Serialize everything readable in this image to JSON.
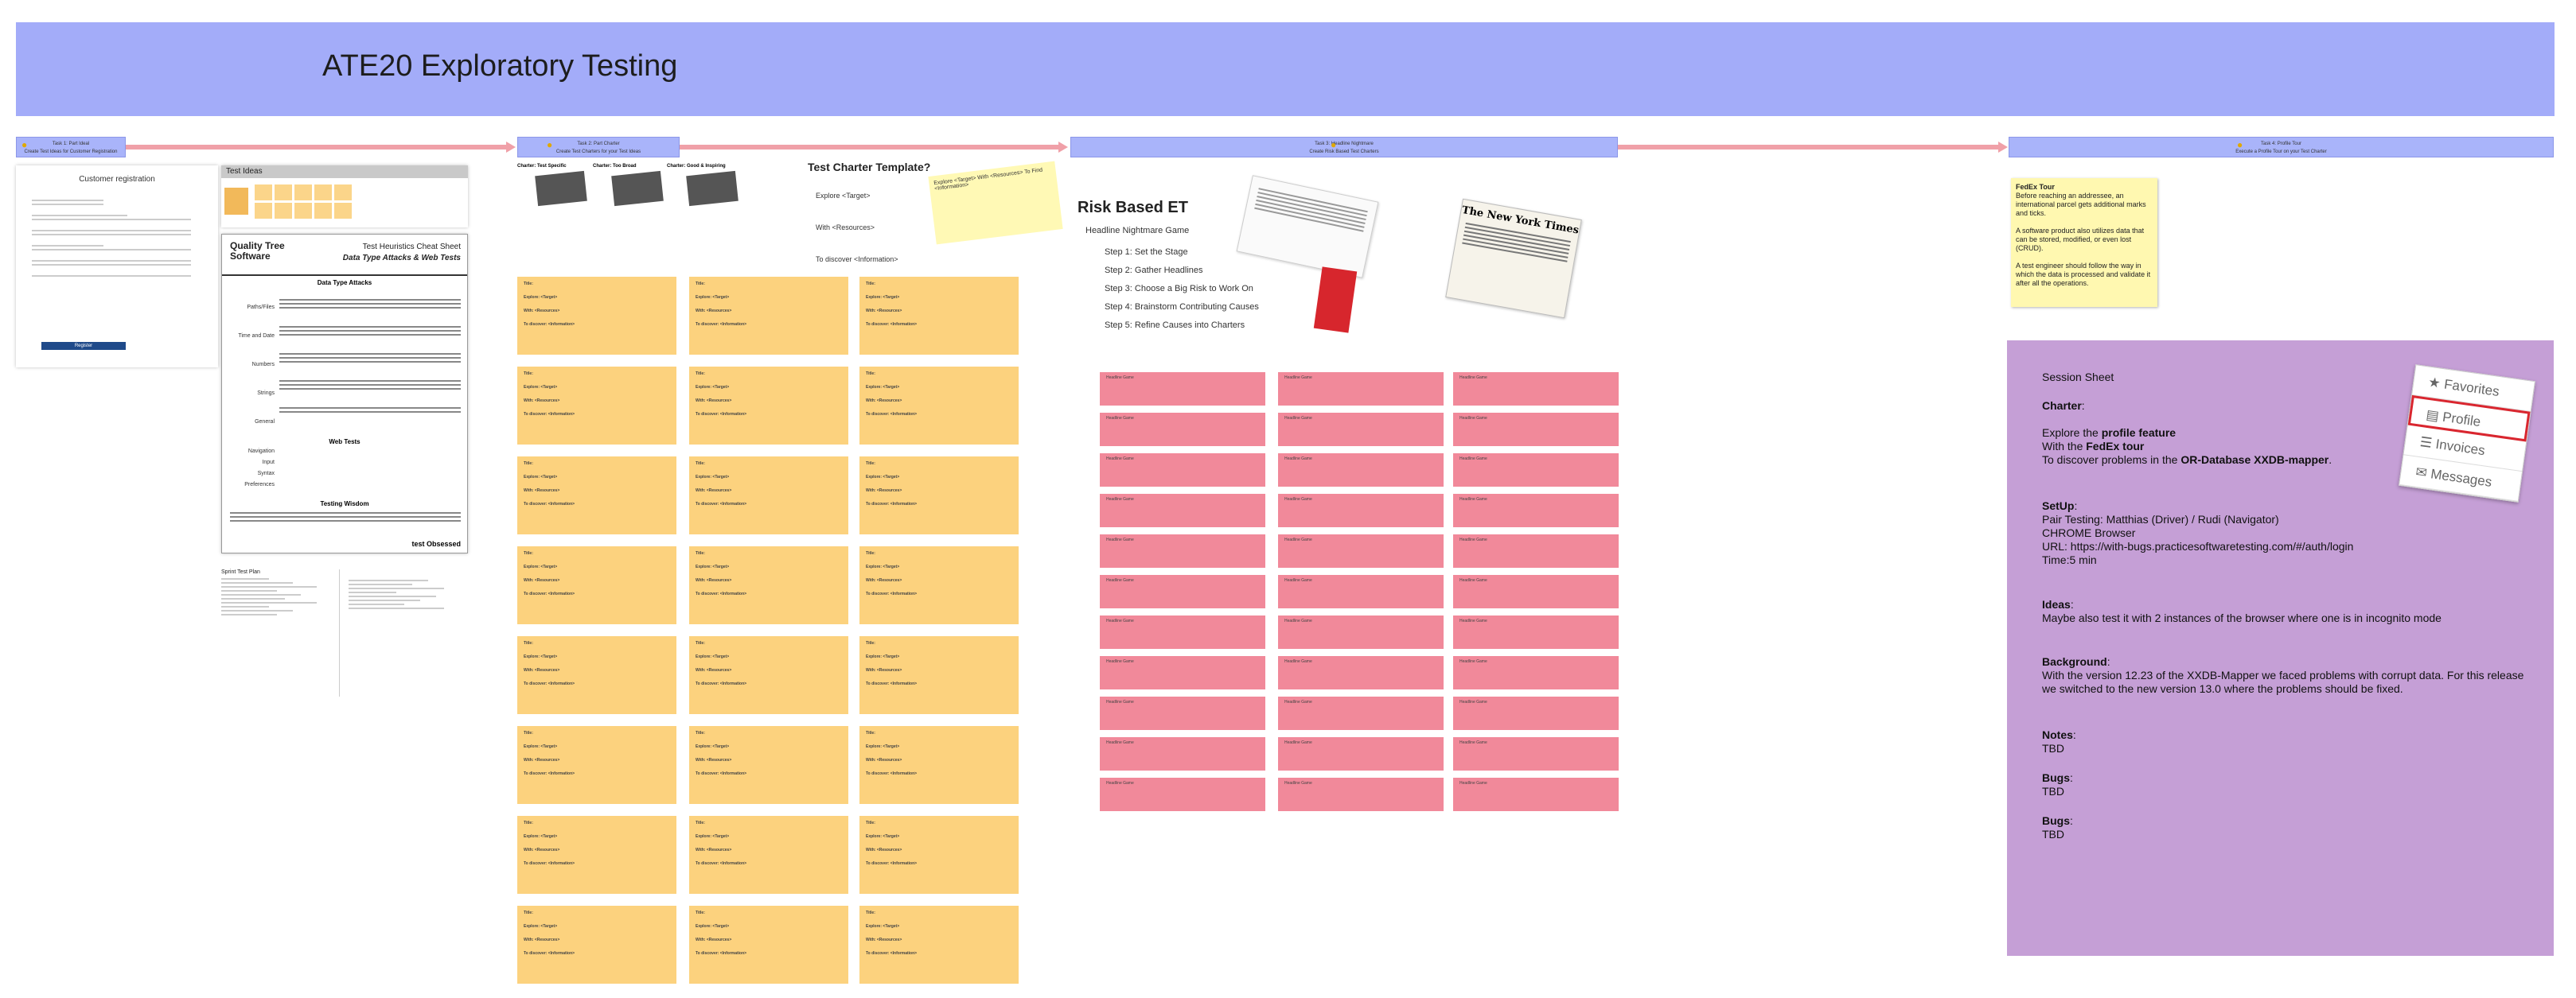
{
  "banner": {
    "title": "ATE20 Exploratory Testing"
  },
  "tasks": [
    {
      "label": "Task 1: Part Ideal",
      "sub": "Create Test Ideas for Customer Registration"
    },
    {
      "label": "Task 2: Part Charter",
      "sub": "Create Test Charters for your Test Ideas"
    },
    {
      "label": "Task 3: Headline Nightmare",
      "sub": "Create Risk Based Test Charters"
    },
    {
      "label": "Task 4: Profile Tour",
      "sub": "Execute a Profile Tour on your Test Charter"
    }
  ],
  "registration": {
    "title": "Customer registration",
    "submit": "Register"
  },
  "test_ideas": {
    "title": "Test Ideas"
  },
  "cheat_sheet": {
    "brand": "Quality Tree Software",
    "title": "Test Heuristics Cheat Sheet",
    "subtitle": "Data Type Attacks & Web Tests",
    "section1": "Data Type Attacks",
    "rows": [
      "Paths/Files",
      "Time and Date",
      "Numbers",
      "Strings",
      "General",
      "Navigation",
      "Input",
      "Syntax",
      "Preferences"
    ],
    "section2": "Web Tests",
    "section3": "Testing Wisdom",
    "footer": "test Obsessed"
  },
  "sprint_plan": {
    "title": "Sprint Test Plan"
  },
  "charter_template": {
    "title": "Test Charter Template?",
    "items": [
      "Explore <Target>",
      "With <Resources>",
      "To discover <Information>"
    ],
    "note": "Explore <Target> With <Resources> To Find <Information>"
  },
  "charter_cards": {
    "row_labels": [
      "Charter: Test Specific",
      "Charter: Too Broad",
      "Charter: Good & Inspiring"
    ],
    "card_title": "Title:",
    "explore": "Explore: <Target>",
    "with": "With: <Resources>",
    "discover": "To discover: <Information>"
  },
  "risk_based": {
    "title": "Risk Based ET",
    "bullet": "Headline Nightmare Game",
    "steps": [
      "Step 1: Set the Stage",
      "Step 2: Gather Headlines",
      "Step 3: Choose a Big Risk to Work On",
      "Step 4: Brainstorm Contributing Causes",
      "Step 5: Refine Causes into Charters"
    ],
    "headline_label": "Headline Game",
    "newspaper": "The New York Times"
  },
  "fedex": {
    "title": "FedEx Tour",
    "p1": "Before reaching an addressee, an international parcel gets additional marks and ticks.",
    "p2": "A software product also utilizes data that can be stored, modified, or even lost (CRUD).",
    "p3": "A test engineer should follow the way in which the data is processed and validate it after all the operations."
  },
  "session": {
    "title": "Session Sheet",
    "charter_label": "Charter",
    "charter_l1a": "Explore the ",
    "charter_l1b": "profile feature",
    "charter_l2a": "With the ",
    "charter_l2b": "FedEx tour",
    "charter_l3a": "To discover problems in the ",
    "charter_l3b": "OR-Database XXDB-mapper",
    "setup_label": "SetUp",
    "setup_lines": [
      "Pair Testing: Matthias (Driver) / Rudi (Navigator)",
      "CHROME Browser",
      "URL: https://with-bugs.practicesoftwaretesting.com/#/auth/login",
      "Time:5 min"
    ],
    "ideas_label": "Ideas",
    "ideas_text": "Maybe also test it with 2 instances of the browser where one is in incognito mode",
    "background_label": "Background",
    "background_text": "With the version 12.23 of the XXDB-Mapper we faced problems with corrupt data. For this release we switched to the new version 13.0 where the problems should be fixed.",
    "notes_label": "Notes",
    "notes_text": "TBD",
    "bugs_label": "Bugs",
    "bugs_text": "TBD",
    "bugs2_label": "Bugs",
    "bugs2_text": "TBD"
  },
  "profile_menu": {
    "items": [
      "Favorites",
      "Profile",
      "Invoices",
      "Messages"
    ],
    "icons": [
      "star-icon",
      "id-card-icon",
      "list-icon",
      "chat-icon"
    ],
    "selected": "Profile"
  },
  "colors": {
    "banner": "#a3acf9",
    "orange_sticky": "#fcd27e",
    "pink_sticky": "#f1899a",
    "session_bg": "#c59fd6",
    "menu_highlight": "#d9262f"
  }
}
